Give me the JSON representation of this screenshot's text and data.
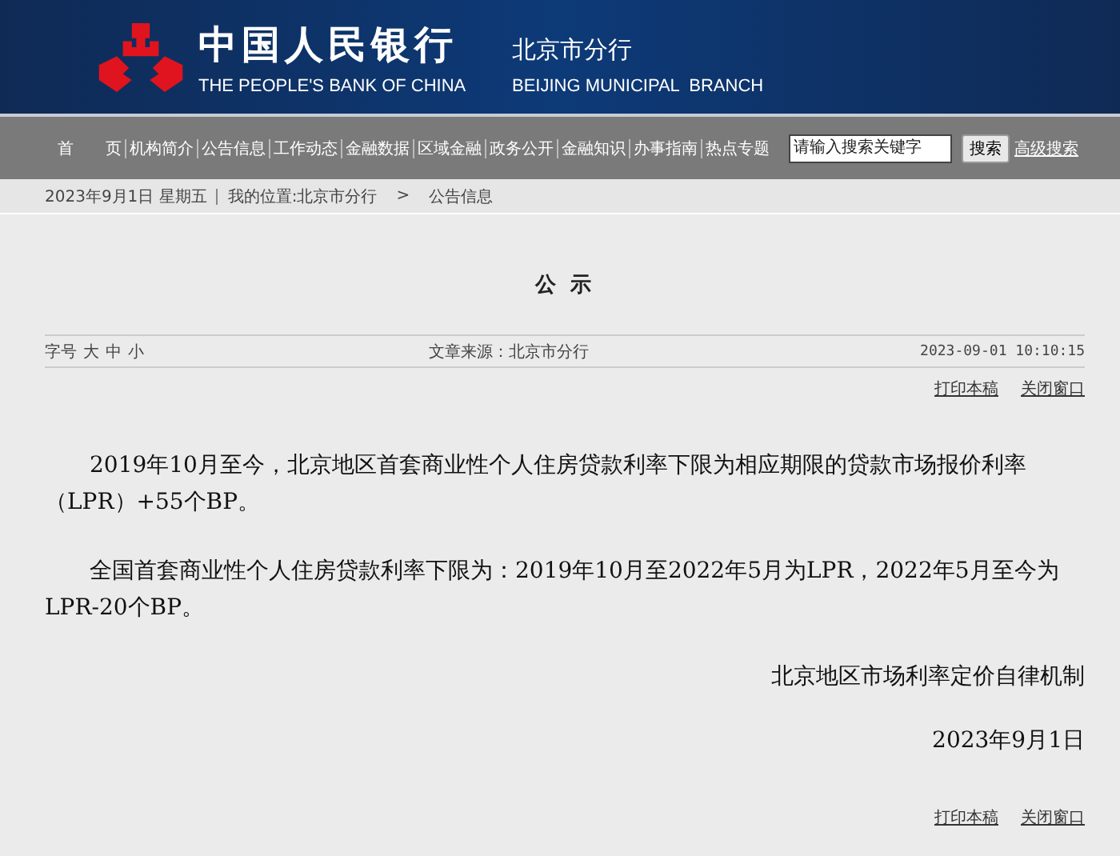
{
  "header": {
    "title_cn": "中国人民银行",
    "title_en": "THE PEOPLE'S BANK OF CHINA",
    "branch_cn": "北京市分行",
    "branch_en": "BEIJING MUNICIPAL  BRANCH"
  },
  "nav": {
    "items": [
      "首　　页",
      "机构简介",
      "公告信息",
      "工作动态",
      "金融数据",
      "区域金融",
      "政务公开",
      "金融知识",
      "办事指南",
      "热点专题"
    ],
    "search": {
      "placeholder": "请输入搜索关键字"
    },
    "search_button": "搜索",
    "advanced": "高级搜索"
  },
  "breadcrumb": {
    "date": "2023年9月1日  星期五",
    "location": "我的位置:北京市分行",
    "separator": ">",
    "current": "公告信息"
  },
  "article": {
    "title": "公 示",
    "font_size_label": "字号",
    "font_sizes": [
      "大",
      "中",
      "小"
    ],
    "source": "文章来源：北京市分行",
    "datetime": "2023-09-01  10:10:15",
    "links_top": [
      "打印本稿",
      "关闭窗口"
    ],
    "paragraphs": [
      "2019年10月至今，北京地区首套商业性个人住房贷款利率下限为相应期限的贷款市场报价利率（LPR）+55个BP。",
      "全国首套商业性个人住房贷款利率下限为：2019年10月至2022年5月为LPR，2022年5月至今为LPR-20个BP。"
    ],
    "signature": "北京地区市场利率定价自律机制",
    "date": "2023年9月1日",
    "links_bottom": [
      "打印本稿",
      "关闭窗口"
    ]
  }
}
